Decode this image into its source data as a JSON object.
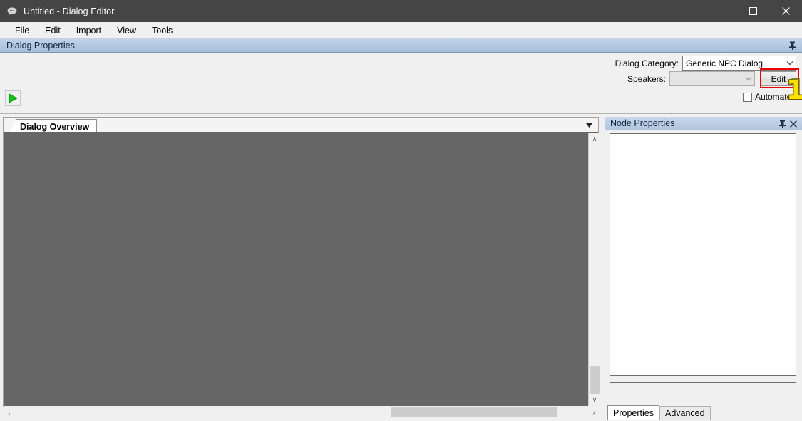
{
  "window": {
    "title": "Untitled - Dialog Editor",
    "icon": "speech-bubble-icon",
    "controls": {
      "minimize": "─",
      "maximize": "☐",
      "close": "✕"
    }
  },
  "menubar": {
    "items": [
      {
        "label": "File"
      },
      {
        "label": "Edit"
      },
      {
        "label": "Import"
      },
      {
        "label": "View"
      },
      {
        "label": "Tools"
      }
    ]
  },
  "dialog_properties": {
    "title": "Dialog Properties",
    "pin_icon": "⁐",
    "play_button_label": "▶",
    "category": {
      "label": "Dialog Category:",
      "value": "Generic NPC Dialog",
      "arrow": "⌄"
    },
    "speakers": {
      "label": "Speakers:",
      "value": "",
      "arrow": "⌄",
      "edit_button": "Edit"
    },
    "automated": {
      "label": "Automated",
      "checked": false
    }
  },
  "main_tabs": {
    "active": "Dialog Overview",
    "dropdown_icon": "▼"
  },
  "canvas": {
    "background_color": "#666666",
    "vscroll": {
      "up": "∧",
      "down": "∨"
    },
    "hscroll": {
      "left": "‹",
      "right": "›"
    }
  },
  "node_properties": {
    "title": "Node Properties",
    "pin_icon": "⁐",
    "close_icon": "✕",
    "content": "",
    "field_value": "",
    "tabs": [
      {
        "label": "Properties",
        "active": true
      },
      {
        "label": "Advanced",
        "active": false
      }
    ]
  },
  "annotation": {
    "number": "1",
    "highlight_color": "#ee0000",
    "number_color": "#ffe000"
  }
}
